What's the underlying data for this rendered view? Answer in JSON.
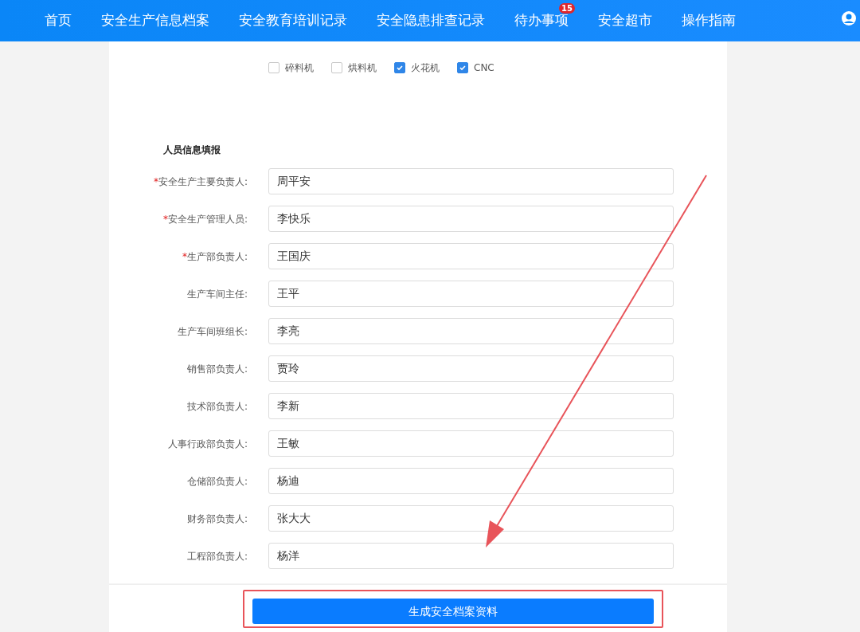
{
  "nav": {
    "items": [
      {
        "label": "首页"
      },
      {
        "label": "安全生产信息档案"
      },
      {
        "label": "安全教育培训记录"
      },
      {
        "label": "安全隐患排查记录"
      },
      {
        "label": "待办事项",
        "badge": "15"
      },
      {
        "label": "安全超市"
      },
      {
        "label": "操作指南"
      }
    ]
  },
  "equipment": [
    {
      "label": "碎料机",
      "checked": false
    },
    {
      "label": "烘料机",
      "checked": false
    },
    {
      "label": "火花机",
      "checked": true
    },
    {
      "label": "CNC",
      "checked": true
    }
  ],
  "section_title": "人员信息填报",
  "fields": [
    {
      "label": "安全生产主要负责人:",
      "marker": "*",
      "value": "周平安"
    },
    {
      "label": "安全生产管理人员:",
      "marker": "*",
      "value": "李快乐"
    },
    {
      "label": "生产部负责人:",
      "marker": "*",
      "value": "王国庆"
    },
    {
      "label": "生产车间主任:",
      "value": "王平"
    },
    {
      "label": "生产车间班组长:",
      "value": "李亮"
    },
    {
      "label": "销售部负责人:",
      "value": "贾玲"
    },
    {
      "label": "技术部负责人:",
      "value": "李新"
    },
    {
      "label": "人事行政部负责人:",
      "value": "王敏"
    },
    {
      "label": "仓储部负责人:",
      "value": "杨迪"
    },
    {
      "label": "财务部负责人:",
      "value": "张大大"
    },
    {
      "label": "工程部负责人:",
      "value": "杨洋"
    }
  ],
  "submit_button": "生成安全档案资料"
}
